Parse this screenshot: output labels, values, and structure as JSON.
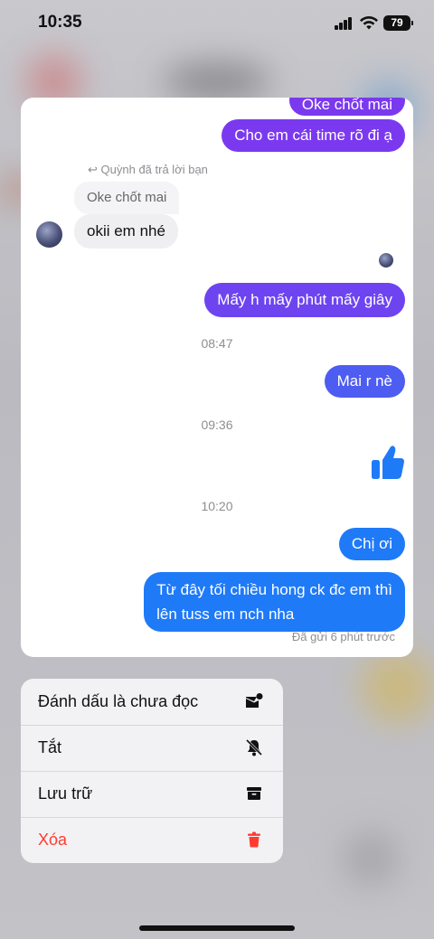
{
  "status_bar": {
    "time": "10:35",
    "battery": "79"
  },
  "chat": {
    "messages": {
      "m_top": "Oke chốt mai",
      "m1": "Cho em cái time rõ đi ạ",
      "reply_meta": "Quỳnh đã trả lời bạn",
      "quoted": "Oke chốt mai",
      "received": "okii em nhé",
      "m2": "Mấy h mấy phút mấy giây",
      "ts1": "08:47",
      "m3": "Mai r nè",
      "ts2": "09:36",
      "ts3": "10:20",
      "m4": "Chị ơi",
      "m5_line1": "Từ đây tối chiều hong ck đc em thì",
      "m5_line2": "lên tuss em nch nha",
      "sent_note": "Đã gửi 6 phút trước"
    },
    "colors": {
      "purple": "#7b39ef",
      "blue": "#1f7af8",
      "like": "#1f7af8"
    }
  },
  "menu": {
    "items": [
      {
        "label": "Đánh dấu là chưa đọc",
        "icon": "mark-unread-icon"
      },
      {
        "label": "Tắt",
        "icon": "bell-slash-icon"
      },
      {
        "label": "Lưu trữ",
        "icon": "archive-icon"
      },
      {
        "label": "Xóa",
        "icon": "trash-icon",
        "color": "#ff3b30"
      }
    ]
  }
}
